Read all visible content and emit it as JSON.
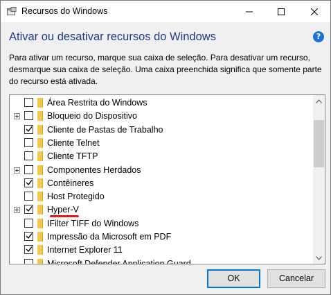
{
  "window": {
    "title": "Recursos do Windows",
    "controls": {
      "minimize": "—",
      "maximize": "□",
      "close": "✕"
    }
  },
  "header": {
    "title": "Ativar ou desativar recursos do Windows",
    "help_icon": "?"
  },
  "description": "Para ativar um recurso, marque sua caixa de seleção. Para desativar um recurso, desmarque sua caixa de seleção. Uma caixa preenchida significa que somente parte do recurso está ativada.",
  "features": [
    {
      "label": "Área Restrita do Windows",
      "checked": false,
      "expandable": false
    },
    {
      "label": "Bloqueio do Dispositivo",
      "checked": false,
      "expandable": true
    },
    {
      "label": "Cliente de Pastas de Trabalho",
      "checked": true,
      "expandable": false
    },
    {
      "label": "Cliente Telnet",
      "checked": false,
      "expandable": false
    },
    {
      "label": "Cliente TFTP",
      "checked": false,
      "expandable": false
    },
    {
      "label": "Componentes Herdados",
      "checked": false,
      "expandable": true
    },
    {
      "label": "Contêineres",
      "checked": true,
      "expandable": false
    },
    {
      "label": "Host Protegido",
      "checked": false,
      "expandable": false
    },
    {
      "label": "Hyper-V",
      "checked": true,
      "expandable": true,
      "highlighted": true
    },
    {
      "label": "IFilter TIFF do Windows",
      "checked": false,
      "expandable": false
    },
    {
      "label": "Impressão da Microsoft em PDF",
      "checked": true,
      "expandable": false
    },
    {
      "label": "Internet Explorer 11",
      "checked": true,
      "expandable": false
    },
    {
      "label": "Microsoft Defender Application Guard",
      "checked": false,
      "expandable": false
    }
  ],
  "buttons": {
    "ok": "OK",
    "cancel": "Cancelar"
  },
  "colors": {
    "header_title": "#1f3b8f",
    "accent": "#0078d7",
    "highlight_underline": "#e5191b",
    "folder": "#f2c94c"
  }
}
